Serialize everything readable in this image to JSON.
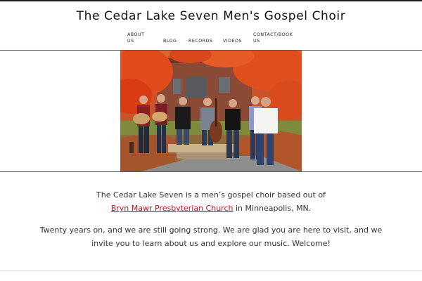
{
  "site": {
    "title": "The Cedar Lake Seven Men's Gospel Choir"
  },
  "nav": {
    "about": "About us",
    "blog": "Blog",
    "records": "Records",
    "videos": "Videos",
    "contact": "Contact/Book us"
  },
  "intro": {
    "line1": "The Cedar Lake Seven is a men’s gospel choir based out of",
    "church_link": "Bryn Mawr Presbyterian Church",
    "line2_suffix": " in Minneapolis, MN.",
    "paragraph2_line1": "Twenty years on, and we are still going strong. We are glad you are here to visit, and we",
    "paragraph2_line2": "invite you to learn about us and explore our music. Welcome!"
  },
  "colors": {
    "link": "#b0161e",
    "text": "#333333",
    "foliage": "#e2451f"
  },
  "photo": {
    "description_icon": "choir-photo"
  }
}
